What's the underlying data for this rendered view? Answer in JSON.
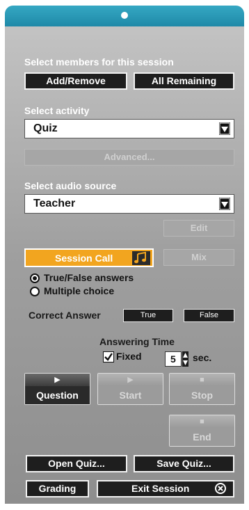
{
  "members": {
    "heading": "Select members for this session",
    "add_remove": "Add/Remove",
    "all_remaining": "All Remaining"
  },
  "activity": {
    "heading": "Select activity",
    "selected": "Quiz",
    "advanced": "Advanced..."
  },
  "audio": {
    "heading": "Select audio source",
    "selected": "Teacher",
    "edit": "Edit"
  },
  "session_call": {
    "label": "Session Call",
    "mix": "Mix",
    "accent": "#f2a51f"
  },
  "answer_mode": {
    "options": [
      "True/False answers",
      "Multiple choice"
    ],
    "selected_index": 0
  },
  "correct_answer": {
    "label": "Correct Answer",
    "true_label": "True",
    "false_label": "False"
  },
  "answering_time": {
    "heading": "Answering Time",
    "fixed_label": "Fixed",
    "fixed_checked": true,
    "seconds": "5",
    "unit": "sec."
  },
  "transport": {
    "question": "Question",
    "start": "Start",
    "stop": "Stop",
    "end": "End"
  },
  "footer": {
    "open_quiz": "Open Quiz...",
    "save_quiz": "Save Quiz...",
    "grading": "Grading",
    "exit_session": "Exit Session"
  },
  "colors": {
    "titlebar": "#1f89a8",
    "panel": "#a8a8a8"
  }
}
